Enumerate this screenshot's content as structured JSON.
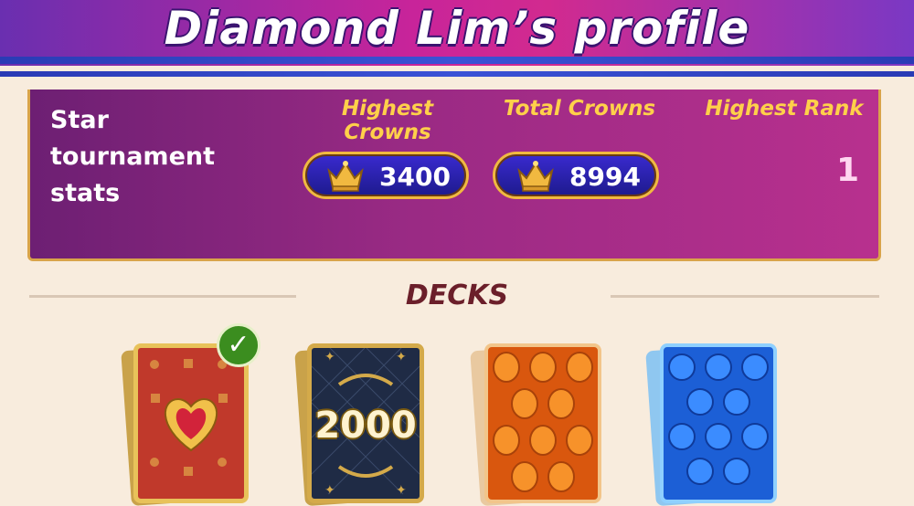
{
  "header": {
    "title": "Diamond Lim’s profile"
  },
  "stats": {
    "label": "Star tournament stats",
    "columns": {
      "highest_crowns": {
        "title": "Highest Crowns",
        "value": "3400"
      },
      "total_crowns": {
        "title": "Total Crowns",
        "value": "8994"
      },
      "highest_rank": {
        "title": "Highest Rank",
        "value": "1"
      }
    }
  },
  "decks": {
    "title": "DECKS",
    "items": [
      {
        "name": "heart-deck",
        "selected": true,
        "label": ""
      },
      {
        "name": "2000-deck",
        "selected": false,
        "label": "2000"
      },
      {
        "name": "orange-candy-deck",
        "selected": false,
        "label": ""
      },
      {
        "name": "blue-candy-deck",
        "selected": false,
        "label": ""
      }
    ],
    "selected_icon": "checkmark-icon"
  },
  "colors": {
    "accent_gold": "#f1b940",
    "panel_purple": "#9a2a84",
    "pill_blue": "#1d1a8c",
    "selected_green": "#3b8d1f"
  }
}
